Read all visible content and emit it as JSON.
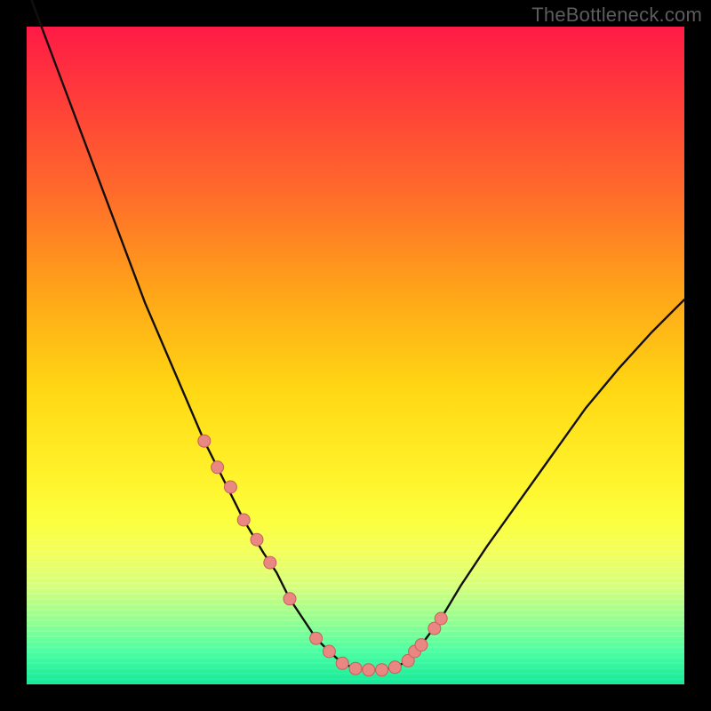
{
  "watermark": "TheBottleneck.com",
  "colors": {
    "frame_bg": "#000000",
    "gradient_top": "#ff1a46",
    "gradient_bottom": "#17e896",
    "curve_stroke": "#130f0f",
    "marker_fill": "#e98783",
    "marker_stroke": "#c85f5b"
  },
  "chart_data": {
    "type": "line",
    "title": "",
    "xlabel": "",
    "ylabel": "",
    "xlim": [
      0,
      100
    ],
    "ylim": [
      0,
      100
    ],
    "x": [
      0,
      3,
      6,
      9,
      12,
      15,
      18,
      21,
      24,
      27,
      30,
      33,
      36,
      38,
      40,
      42,
      44,
      46,
      48,
      50,
      52,
      54,
      56,
      58,
      60,
      63,
      66,
      70,
      75,
      80,
      85,
      90,
      95,
      100
    ],
    "values": [
      106,
      98,
      90,
      82,
      74,
      66,
      58,
      51,
      44,
      37,
      31,
      25,
      20,
      17,
      13,
      10,
      7,
      5,
      3.2,
      2.4,
      2.2,
      2.2,
      2.6,
      3.6,
      6,
      10,
      15,
      21,
      28,
      35,
      42,
      48,
      53.5,
      58.5
    ],
    "markers_x": [
      27,
      29,
      31,
      33,
      35,
      37,
      40,
      44,
      46,
      48,
      50,
      52,
      54,
      56,
      58,
      59,
      60,
      62,
      63
    ],
    "markers_y": [
      37,
      33,
      30,
      25,
      22,
      18.5,
      13,
      7,
      5,
      3.2,
      2.4,
      2.2,
      2.2,
      2.6,
      3.6,
      5,
      6,
      8.5,
      10
    ]
  }
}
